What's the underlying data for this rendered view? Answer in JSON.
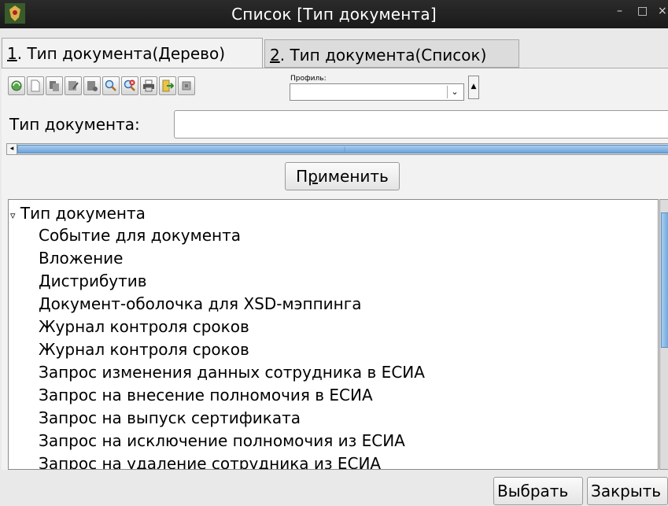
{
  "window": {
    "title": "Список [Тип документа]",
    "minimize": "–",
    "maximize": "□",
    "close": "×"
  },
  "tabs": [
    {
      "mnemonic": "1",
      "rest": ". Тип документа(Дерево)"
    },
    {
      "mnemonic": "2",
      "rest": ". Тип документа(Список)"
    }
  ],
  "toolbar": {
    "icons": [
      "refresh-icon",
      "new-document-icon",
      "copy-icon",
      "edit-icon",
      "delete-icon",
      "search-icon",
      "clear-search-icon",
      "print-icon",
      "export-icon",
      "settings-icon"
    ],
    "profile_label": "Профиль:",
    "profile_value": ""
  },
  "filter": {
    "label": "Тип документа:",
    "value": ""
  },
  "apply_button": {
    "before": "П",
    "mnemonic": "р",
    "after": "именить"
  },
  "tree": {
    "root": "Тип документа",
    "items": [
      "Событие для документа",
      "Вложение",
      "Дистрибутив",
      "Документ-оболочка для XSD-мэппинга",
      "Журнал контроля сроков",
      "Журнал контроля сроков",
      "Запрос изменения данных сотрудника в ЕСИА",
      "Запрос на внесение полномочия в ЕСИА",
      "Запрос на выпуск сертификата",
      "Запрос на исключение полномочия из ЕСИА",
      "Запрос на удаление сотрудника из ЕСИА"
    ]
  },
  "footer": {
    "select_label": "Выбрать",
    "close_label": "Закрыть"
  },
  "colors": {
    "titlebar": "#1f1f1f",
    "scroll_thumb": "#6aa3da"
  }
}
